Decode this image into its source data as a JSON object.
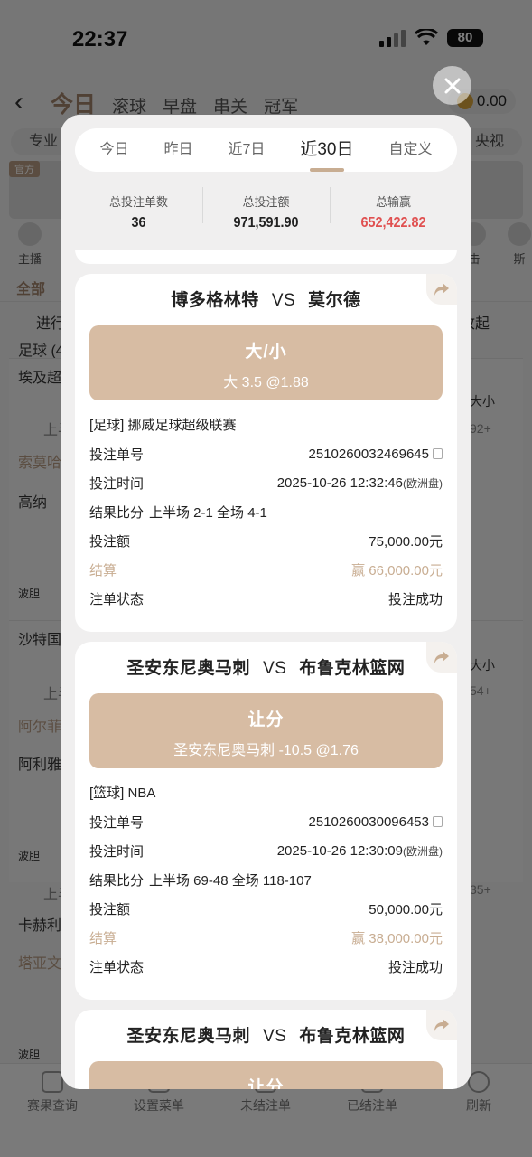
{
  "status": {
    "time": "22:37",
    "battery": "80"
  },
  "background": {
    "tabs": [
      "今日",
      "滚球",
      "早盘",
      "串关",
      "冠军"
    ],
    "coin_balance": "0.00",
    "pill_left": "专业",
    "pill_right": "央视",
    "official": "官方",
    "icon_labels": [
      "主播",
      "击",
      "斯"
    ],
    "filter_all": "全部",
    "live_label": "进行",
    "collapse_label": "收起",
    "football_count": "足球 (4",
    "list_lines": [
      "埃及超",
      "上半",
      "索莫哈",
      "高纳",
      "波胆",
      "沙特国",
      "上半",
      "阿尔菲",
      "阿利雅",
      "波胆",
      "上半",
      "卡赫利",
      "塔亚文",
      "波胆"
    ],
    "right_labels": [
      "大小",
      "92+",
      "大小",
      "54+",
      "35+"
    ],
    "bottom_tabs": [
      "赛果查询",
      "设置菜单",
      "未结注单",
      "已结注单",
      "刷新"
    ]
  },
  "modal": {
    "tabs": [
      {
        "label": "今日",
        "active": false
      },
      {
        "label": "昨日",
        "active": false
      },
      {
        "label": "近7日",
        "active": false
      },
      {
        "label": "近30日",
        "active": true
      },
      {
        "label": "自定义",
        "active": false
      }
    ],
    "stats": [
      {
        "label": "总投注单数",
        "value": "36"
      },
      {
        "label": "总投注额",
        "value": "971,591.90"
      },
      {
        "label": "总输赢",
        "value": "652,422.82"
      }
    ],
    "field_labels": {
      "order_no": "投注单号",
      "time": "投注时间",
      "score": "结果比分",
      "amount": "投注额",
      "settle": "结算",
      "status": "注单状态"
    },
    "bets": [
      {
        "home": "博多格林特",
        "vs": "VS",
        "away": "莫尔德",
        "market": "大/小",
        "pick": "大 3.5 @1.88",
        "league": "[足球] 挪威足球超级联赛",
        "order_no": "2510260032469645",
        "time": "2025-10-26 12:32:46",
        "time_suffix": "(欧洲盘)",
        "score": "上半场 2-1 全场 4-1",
        "amount": "75,000.00元",
        "settle": "赢 66,000.00元",
        "status": "投注成功"
      },
      {
        "home": "圣安东尼奥马刺",
        "vs": "VS",
        "away": "布鲁克林篮网",
        "market": "让分",
        "pick": "圣安东尼奥马刺 -10.5 @1.76",
        "league": "[篮球] NBA",
        "order_no": "2510260030096453",
        "time": "2025-10-26 12:30:09",
        "time_suffix": "(欧洲盘)",
        "score": "上半场 69-48 全场 118-107",
        "amount": "50,000.00元",
        "settle": "赢 38,000.00元",
        "status": "投注成功"
      },
      {
        "home": "圣安东尼奥马刺",
        "vs": "VS",
        "away": "布鲁克林篮网",
        "market": "让分"
      }
    ]
  }
}
